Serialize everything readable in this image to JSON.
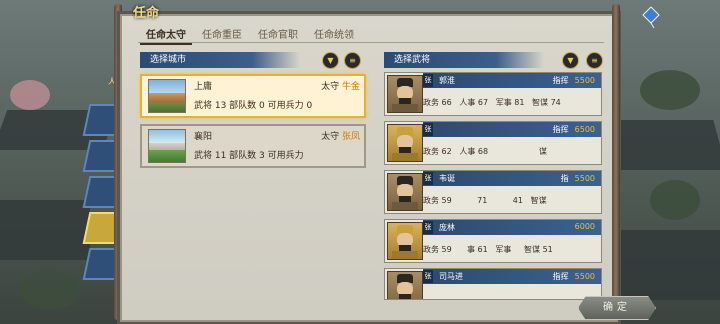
{
  "title": "任命",
  "tabs": [
    "任命太守",
    "任命重臣",
    "任命官职",
    "任命统领"
  ],
  "city_section": {
    "label": "选择城市"
  },
  "general_section": {
    "label": "选择武将"
  },
  "side_label": "人",
  "cities": [
    {
      "name": "上庸",
      "gov_label": "太守",
      "gov_name": "牛金",
      "stats": "武将 13   部队数 0   可用兵力 0",
      "selected": true
    },
    {
      "name": "襄阳",
      "gov_label": "太守",
      "gov_name": "张凤",
      "stats": "武将 11   部队数 3   可用兵力",
      "selected": false
    }
  ],
  "generals": [
    {
      "badge": "张",
      "name": "郭淮",
      "cmd_label": "指挥",
      "cmd_value": "5500",
      "stats": "政务 66   人事 67   军事 81   智谋 74"
    },
    {
      "badge": "张",
      "name": "",
      "cmd_label": "指挥",
      "cmd_value": "6500",
      "stats": "政务 62   人事 68                    谋"
    },
    {
      "badge": "张",
      "name": "韦诞",
      "cmd_label": "指",
      "cmd_value": "5500",
      "stats": "政务 59          71          41   智谋"
    },
    {
      "badge": "张",
      "name": "庞林",
      "cmd_label": "",
      "cmd_value": "6000",
      "stats": "政务 59      事 61   军事     智谋 51"
    },
    {
      "badge": "张",
      "name": "司马进",
      "cmd_label": "指挥",
      "cmd_value": "5500",
      "stats": ""
    }
  ],
  "filter_icon": "funnel-icon",
  "sort_icon": "list-icon",
  "confirm_label": "确定",
  "accent_colors": {
    "panel_blue": "#2c4a70",
    "gold": "#d07a00",
    "command": "#f2b84a"
  }
}
